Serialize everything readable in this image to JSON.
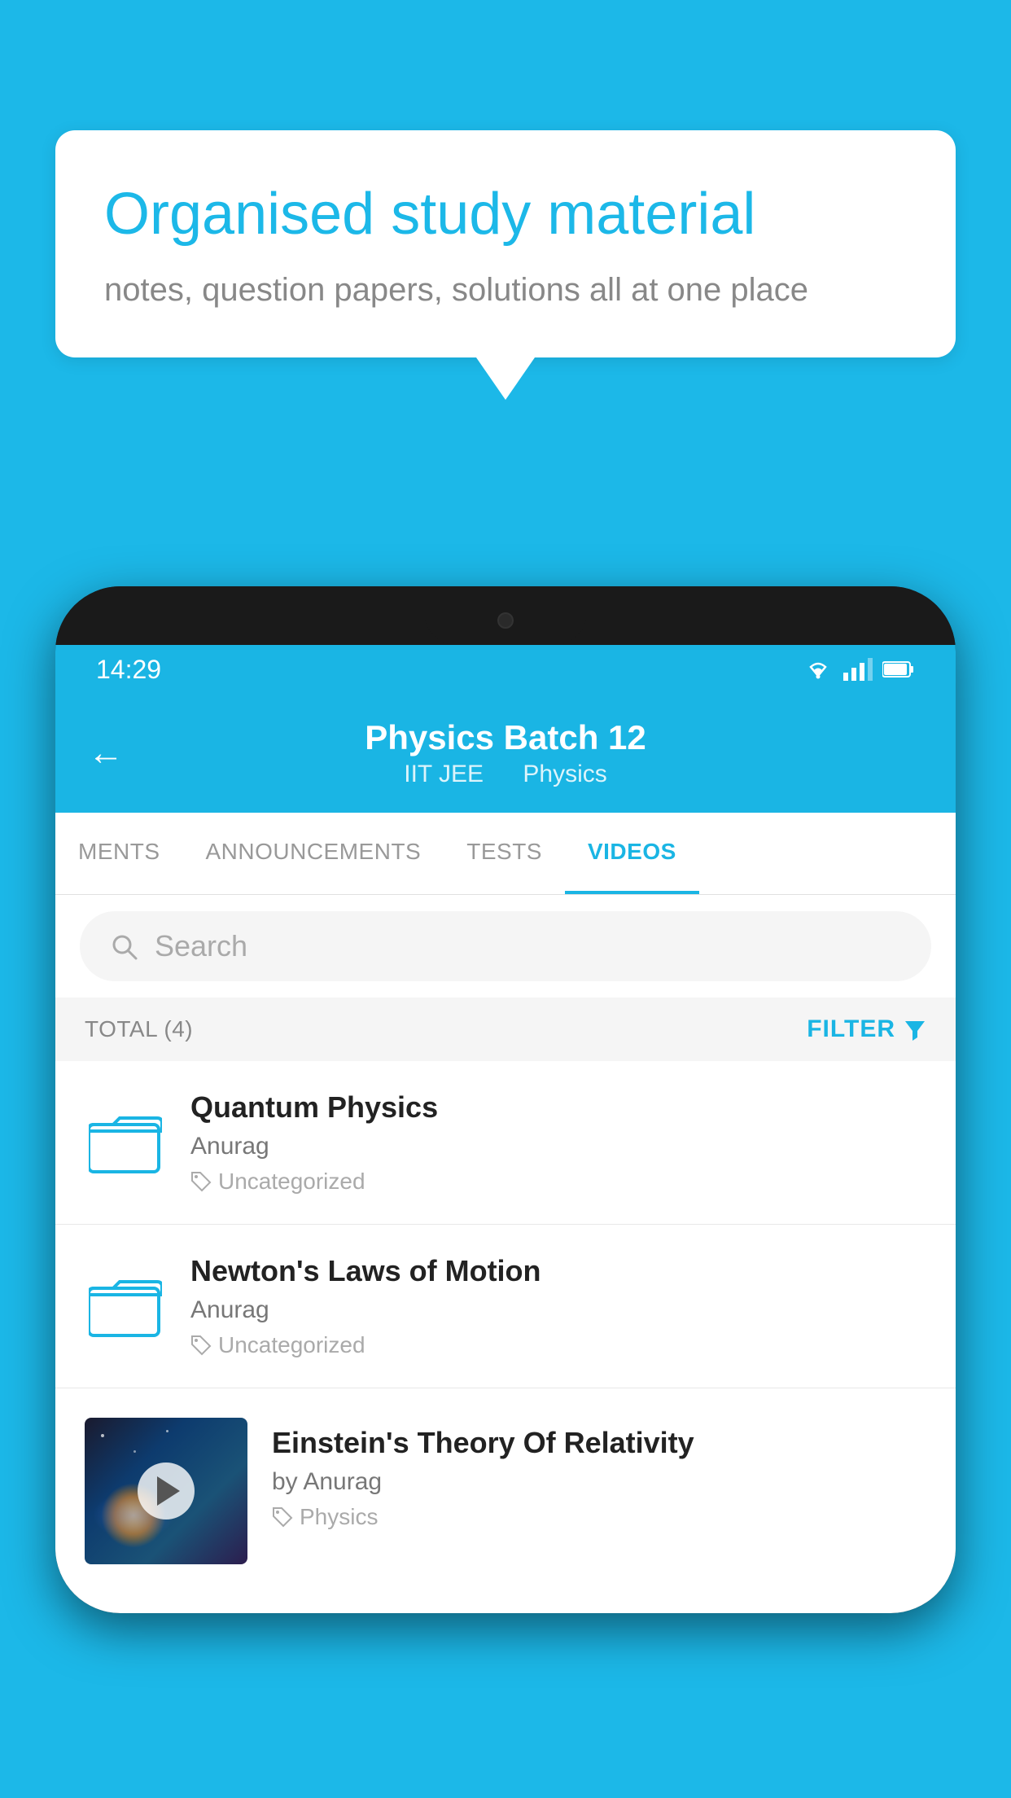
{
  "background_color": "#1cb8e8",
  "speech_bubble": {
    "title": "Organised study material",
    "subtitle": "notes, question papers, solutions all at one place"
  },
  "status_bar": {
    "time": "14:29",
    "wifi": "wifi",
    "signal": "signal",
    "battery": "battery"
  },
  "header": {
    "back_label": "←",
    "title": "Physics Batch 12",
    "subtitle_part1": "IIT JEE",
    "subtitle_part2": "Physics"
  },
  "tabs": [
    {
      "label": "MENTS",
      "active": false
    },
    {
      "label": "ANNOUNCEMENTS",
      "active": false
    },
    {
      "label": "TESTS",
      "active": false
    },
    {
      "label": "VIDEOS",
      "active": true
    }
  ],
  "search": {
    "placeholder": "Search"
  },
  "filter_row": {
    "total_label": "TOTAL (4)",
    "filter_label": "FILTER"
  },
  "video_list": [
    {
      "id": 1,
      "title": "Quantum Physics",
      "author": "Anurag",
      "tag": "Uncategorized",
      "type": "folder",
      "has_thumbnail": false
    },
    {
      "id": 2,
      "title": "Newton's Laws of Motion",
      "author": "Anurag",
      "tag": "Uncategorized",
      "type": "folder",
      "has_thumbnail": false
    },
    {
      "id": 3,
      "title": "Einstein's Theory Of Relativity",
      "author": "by Anurag",
      "tag": "Physics",
      "type": "video",
      "has_thumbnail": true
    }
  ],
  "icons": {
    "folder": "folder-icon",
    "tag": "tag-icon",
    "search": "search-icon",
    "filter": "filter-icon",
    "back": "back-arrow-icon",
    "play": "play-icon"
  }
}
